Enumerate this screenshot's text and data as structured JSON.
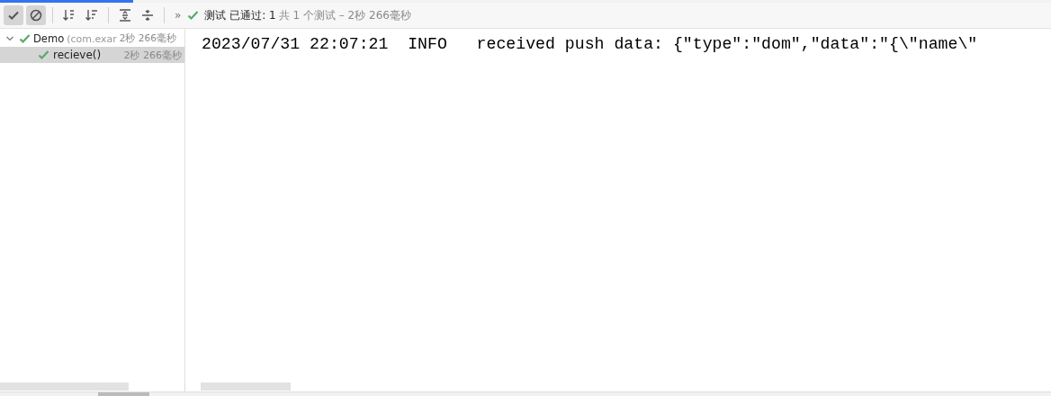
{
  "toolbar": {
    "buttons": [
      {
        "kind": "passed",
        "selected": true
      },
      {
        "kind": "ignored",
        "selected": true
      },
      {
        "kind": "sort-alpha",
        "selected": false
      },
      {
        "kind": "sort-duration",
        "selected": false
      },
      {
        "kind": "expand",
        "selected": false
      },
      {
        "kind": "collapse",
        "selected": false
      }
    ],
    "more": "»",
    "status": {
      "passed": true,
      "label": "测试 已通过: 1",
      "summary": "共 1 个测试 – 2秒 266毫秒"
    }
  },
  "tree": [
    {
      "name": "Demo",
      "detail": "(com.exar",
      "time": "2秒 266毫秒",
      "passed": true,
      "expanded": true,
      "selected": false,
      "children": [
        {
          "name": "recieve()",
          "time": "2秒 266毫秒",
          "passed": true,
          "selected": true
        }
      ]
    }
  ],
  "console": {
    "lines": [
      "2023/07/31 22:07:21  INFO   received push data: {\"type\":\"dom\",\"data\":\"{\\\"name\\\""
    ]
  }
}
